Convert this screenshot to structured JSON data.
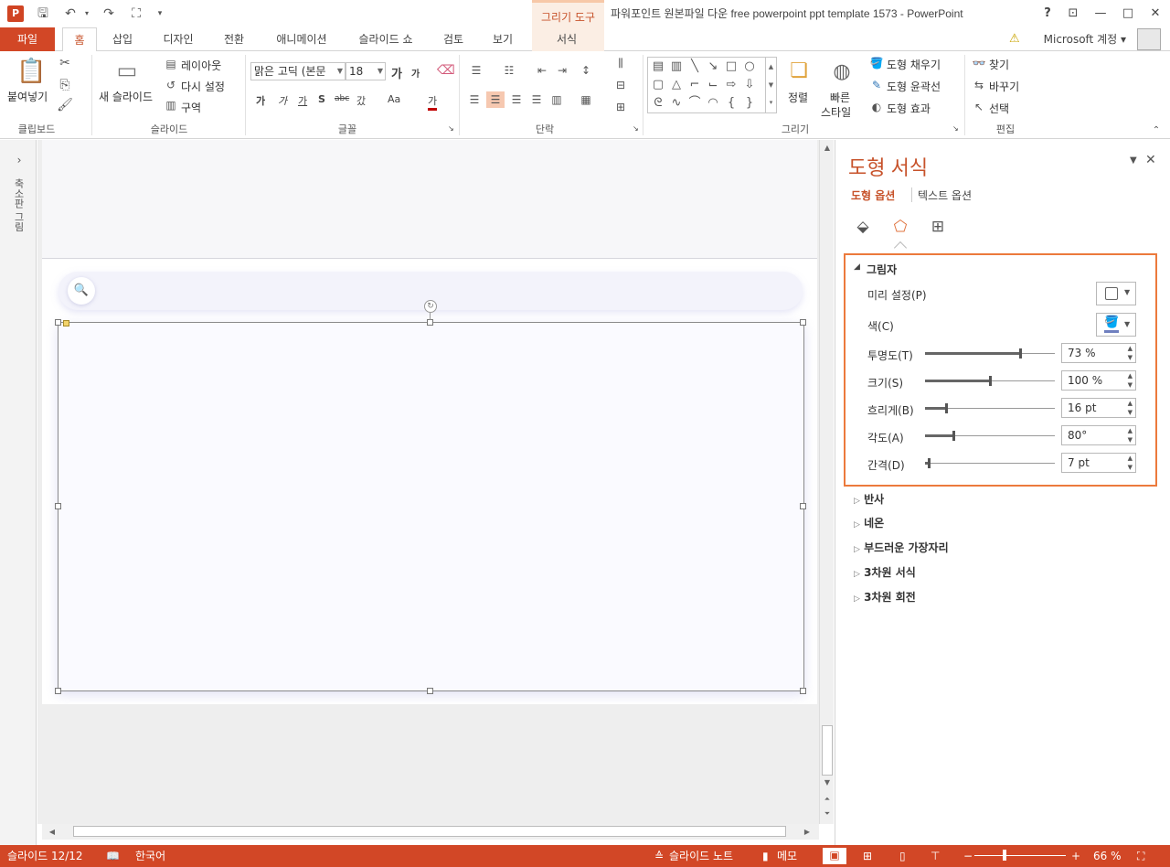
{
  "title_bar": {
    "app_logo": "P",
    "drawing_tools": "그리기 도구",
    "window_title": "파워포인트 원본파일 다운 free powerpoint ppt template 1573 - PowerPoint",
    "help": "?",
    "ribbon_display": "⊡",
    "minimize": "—",
    "maximize": "□",
    "close": "✕"
  },
  "tabs": {
    "file": "파일",
    "home": "홈",
    "insert": "삽입",
    "design": "디자인",
    "transitions": "전환",
    "animations": "애니메이션",
    "slideshow": "슬라이드 쇼",
    "review": "검토",
    "view": "보기",
    "format": "서식",
    "account": "Microsoft 계정"
  },
  "ribbon": {
    "clipboard": {
      "paste": "붙여넣기",
      "label": "클립보드"
    },
    "slides": {
      "new_slide": "새 슬라이드",
      "layout": "레이아웃",
      "reset": "다시 설정",
      "section": "구역",
      "label": "슬라이드"
    },
    "font": {
      "font_name": "맑은 고딕 (본문",
      "font_size": "18",
      "grow": "가",
      "shrink": "가",
      "bold": "가",
      "italic": "가",
      "underline": "가",
      "shadow": "S",
      "strike": "abc",
      "spacing": "갔",
      "case": "Aa",
      "color": "가",
      "label": "글꼴"
    },
    "paragraph": {
      "label": "단락"
    },
    "drawing": {
      "arrange": "정렬",
      "quick_styles_1": "빠른",
      "quick_styles_2": "스타일",
      "shape_fill": "도형 채우기",
      "shape_outline": "도형 윤곽선",
      "shape_effects": "도형 효과",
      "label": "그리기"
    },
    "editing": {
      "find": "찾기",
      "replace": "바꾸기",
      "select": "선택",
      "label": "편집"
    }
  },
  "thumbnail_pane": {
    "label": "축소판 그림"
  },
  "format_pane": {
    "title": "도형 서식",
    "tab_shape": "도형 옵션",
    "tab_text": "텍스트 옵션",
    "shadow_section": "그림자",
    "presets": "미리 설정(P)",
    "color": "색(C)",
    "transparency": {
      "label": "투명도(T)",
      "value": "73 %",
      "fraction": 0.73
    },
    "size": {
      "label": "크기(S)",
      "value": "100 %",
      "fraction": 0.5
    },
    "blur": {
      "label": "흐리게(B)",
      "value": "16 pt",
      "fraction": 0.16
    },
    "angle": {
      "label": "각도(A)",
      "value": "80°",
      "fraction": 0.22
    },
    "distance": {
      "label": "간격(D)",
      "value": "7 pt",
      "fraction": 0.03
    },
    "reflection": "반사",
    "glow": "네온",
    "soft_edges": "부드러운 가장자리",
    "format_3d": "3차원 서식",
    "rotation_3d": "3차원 회전"
  },
  "status": {
    "slide_counter": "슬라이드 12/12",
    "language": "한국어",
    "notes": "슬라이드 노트",
    "comments": "메모",
    "zoom": "66 %"
  }
}
